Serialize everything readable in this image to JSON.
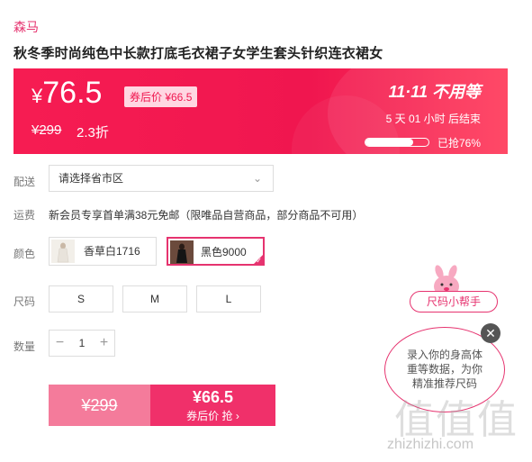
{
  "brand": "森马",
  "title": "秋冬季时尚纯色中长款打底毛衣裙子女学生套头针织连衣裙女",
  "price": {
    "yen": "¥",
    "value": "76.5",
    "coupon_tag": "券后价 ¥66.5",
    "original": "¥299",
    "discount": "2.3折"
  },
  "promo": {
    "title": "11·11 不用等",
    "countdown": "5 天 01 小时 后结束",
    "sold_progress": 0.76,
    "sold_text": "已抢76%"
  },
  "labels": {
    "shipping_to": "配送",
    "freight": "运费",
    "color": "颜色",
    "size": "尺码",
    "quantity": "数量"
  },
  "shipping": {
    "select_value": "请选择省市区",
    "freight_text": "新会员专享首单满38元免邮（限唯品自营商品，部分商品不可用）"
  },
  "colors": [
    {
      "label": "香草白1716",
      "selected": false
    },
    {
      "label": "黑色9000",
      "selected": true
    }
  ],
  "sizes": [
    "S",
    "M",
    "L"
  ],
  "quantity": {
    "minus": "−",
    "value": "1",
    "plus": "+"
  },
  "buy": {
    "original_price": "¥299",
    "price": "¥66.5",
    "action": "券后价 抢 ›"
  },
  "size_helper": {
    "title": "尺码小帮手",
    "line1": "录入你的身高体",
    "line2": "重等数据，为你",
    "line3": "精准推荐尺码",
    "close": "✕"
  },
  "watermark": {
    "big": "值值值",
    "small": "zhizhizhi.com"
  },
  "colors_theme": {
    "accent": "#e6336f",
    "banner": "#f61c52"
  }
}
